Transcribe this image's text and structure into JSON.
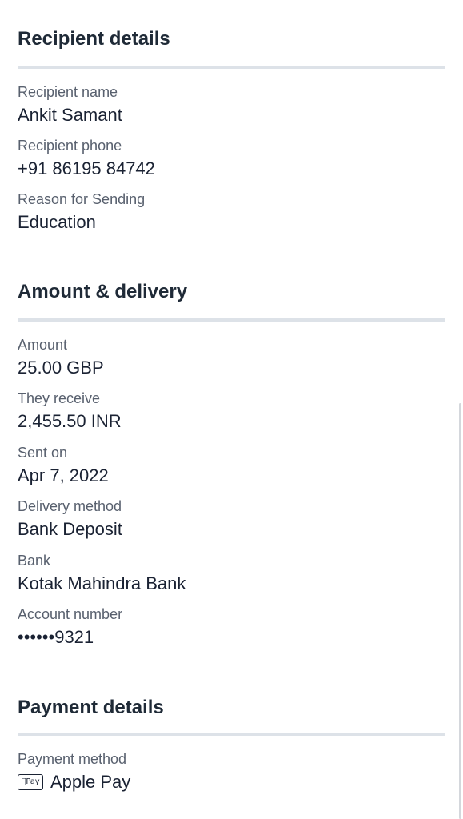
{
  "recipient": {
    "title": "Recipient details",
    "fields": [
      {
        "label": "Recipient name",
        "value": "Ankit Samant"
      },
      {
        "label": "Recipient phone",
        "value": "+91 86195 84742"
      },
      {
        "label": "Reason for Sending",
        "value": "Education"
      }
    ]
  },
  "amount": {
    "title": "Amount & delivery",
    "fields": [
      {
        "label": "Amount",
        "value": "25.00 GBP"
      },
      {
        "label": "They receive",
        "value": "2,455.50 INR"
      },
      {
        "label": "Sent on",
        "value": "Apr 7, 2022"
      },
      {
        "label": "Delivery method",
        "value": "Bank Deposit"
      },
      {
        "label": "Bank",
        "value": "Kotak Mahindra Bank"
      },
      {
        "label": "Account number",
        "value": "••••••9321"
      }
    ]
  },
  "payment": {
    "title": "Payment details",
    "method_label": "Payment method",
    "method_icon": "apple-pay-icon",
    "method_icon_text": "Pay",
    "method_value": "Apple Pay"
  }
}
